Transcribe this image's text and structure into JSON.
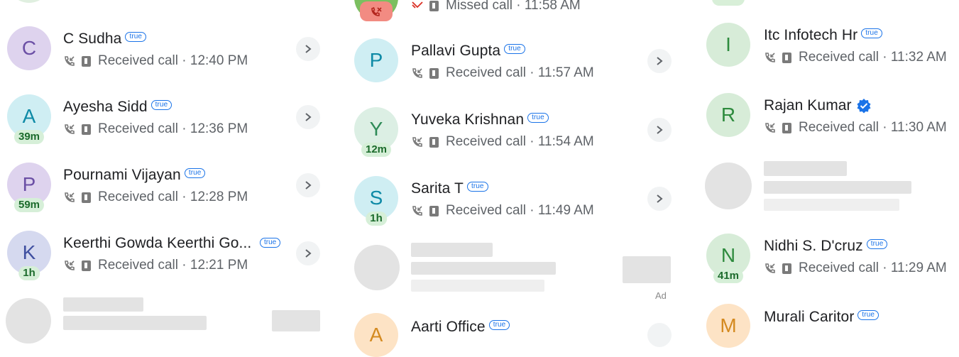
{
  "badge_text": "true",
  "col1": {
    "rows": [
      {
        "initial": "C",
        "name": "C Sudha",
        "status": "Received call · 12:40 PM",
        "duration": ""
      },
      {
        "initial": "A",
        "name": "Ayesha Sidd",
        "status": "Received call · 12:36 PM",
        "duration": "39m"
      },
      {
        "initial": "P",
        "name": "Pournami Vijayan",
        "status": "Received call · 12:28 PM",
        "duration": "59m"
      },
      {
        "initial": "K",
        "name": "Keerthi Gowda Keerthi Go...",
        "status": "Received call · 12:21 PM",
        "duration": "1h"
      }
    ]
  },
  "col2": {
    "top_status": "Missed call · 11:58 AM",
    "rows": [
      {
        "initial": "P",
        "name": "Pallavi Gupta",
        "status": "Received call · 11:57 AM",
        "duration": ""
      },
      {
        "initial": "Y",
        "name": "Yuveka Krishnan",
        "status": "Received call · 11:54 AM",
        "duration": "12m"
      },
      {
        "initial": "S",
        "name": "Sarita T",
        "status": "Received call · 11:49 AM",
        "duration": "1h"
      }
    ],
    "ad_label": "Ad",
    "bottom_initial": "A",
    "bottom_name": "Aarti Office"
  },
  "col3": {
    "rows": [
      {
        "initial": "I",
        "name": "Itc Infotech Hr",
        "status": "Received call · 11:32 AM",
        "duration": ""
      },
      {
        "initial": "R",
        "name": "Rajan Kumar",
        "status": "Received call · 11:30 AM",
        "duration": ""
      },
      {
        "initial": "N",
        "name": "Nidhi S. D'cruz",
        "status": "Received call · 11:29 AM",
        "duration": "41m"
      }
    ],
    "bottom_initial": "M",
    "bottom_name": "Murali Caritor"
  }
}
